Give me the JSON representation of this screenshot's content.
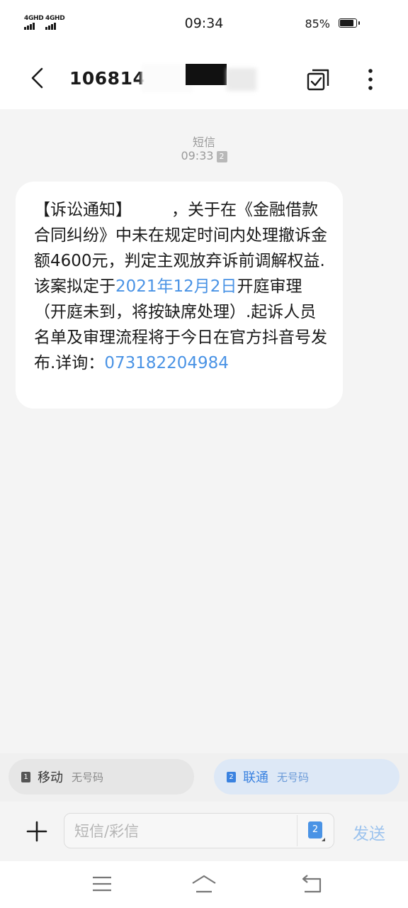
{
  "status_bar": {
    "sim1_label": "4GHD",
    "sim2_label": "4GHD",
    "time": "09:34",
    "battery_text": "85%",
    "battery_level": 0.85
  },
  "header": {
    "title": "1068145"
  },
  "conversation": {
    "channel_label": "短信",
    "time": "09:33",
    "sim_badge": "2",
    "message": {
      "seg1": "【诉讼通知】",
      "seg2": "，关于在《金融借款合同纠纷》中未在规定时间内处理撤诉金额4600元，判定主观放弃诉前调解权益.该案拟定于",
      "date_link": "2021年12月2日",
      "seg3": "开庭审理（开庭未到，将按缺席处理）.起诉人员名单及审理流程将于今日在官方抖音号发布.详询：",
      "phone_link": "073182204984"
    }
  },
  "sim_selector": {
    "sim1": {
      "badge": "1",
      "name": "移动",
      "sub": "无号码"
    },
    "sim2": {
      "badge": "2",
      "name": "联通",
      "sub": "无号码"
    }
  },
  "compose": {
    "placeholder": "短信/彩信",
    "sim_badge": "2",
    "send_label": "发送"
  },
  "colors": {
    "link": "#4a93e5",
    "send_disabled": "#9cc3ee",
    "sim2_highlight": "#dde8f6"
  },
  "icons": [
    "back-arrow-icon",
    "copy-select-icon",
    "more-vertical-icon",
    "plus-icon",
    "menu-icon",
    "home-icon",
    "return-icon"
  ]
}
